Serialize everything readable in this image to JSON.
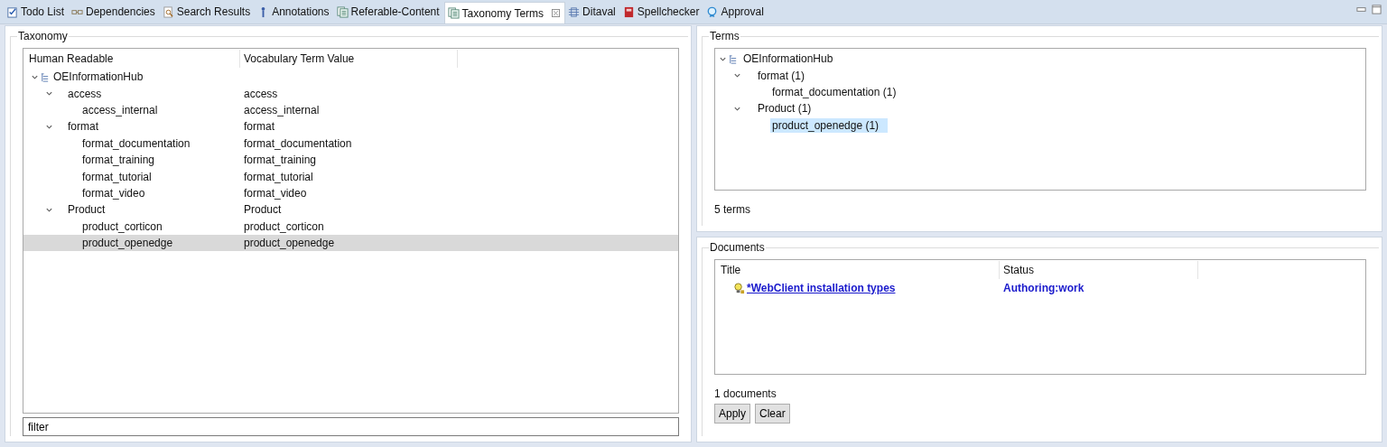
{
  "tabs": [
    {
      "label": "Todo List",
      "kind": "todo",
      "selected": false
    },
    {
      "label": "Dependencies",
      "kind": "dependencies",
      "selected": false
    },
    {
      "label": "Search Results",
      "kind": "search",
      "selected": false
    },
    {
      "label": "Annotations",
      "kind": "annotations",
      "selected": false
    },
    {
      "label": "Referable-Content",
      "kind": "document",
      "selected": false
    },
    {
      "label": "Taxonomy Terms",
      "kind": "document",
      "selected": true
    },
    {
      "label": "Ditaval",
      "kind": "ditaval",
      "selected": false
    },
    {
      "label": "Spellchecker",
      "kind": "spellcheck",
      "selected": false
    },
    {
      "label": "Approval",
      "kind": "approval",
      "selected": false
    }
  ],
  "taxonomy": {
    "title": "Taxonomy",
    "columns": [
      "Human Readable",
      "Vocabulary Term Value"
    ],
    "tree": [
      {
        "label": "OEInformationHub",
        "kind": "vocabulary",
        "expanded": true,
        "selected": false,
        "children": [
          {
            "label": "access",
            "value": "access",
            "expanded": true,
            "selected": false,
            "children": [
              {
                "label": "access_internal",
                "value": "access_internal",
                "selected": false
              }
            ]
          },
          {
            "label": "format",
            "value": "format",
            "expanded": true,
            "selected": false,
            "children": [
              {
                "label": "format_documentation",
                "value": "format_documentation",
                "selected": false
              },
              {
                "label": "format_training",
                "value": "format_training",
                "selected": false
              },
              {
                "label": "format_tutorial",
                "value": "format_tutorial",
                "selected": false
              },
              {
                "label": "format_video",
                "value": "format_video",
                "selected": false
              }
            ]
          },
          {
            "label": "Product",
            "value": "Product",
            "expanded": true,
            "selected": false,
            "children": [
              {
                "label": "product_corticon",
                "value": "product_corticon",
                "selected": false
              },
              {
                "label": "product_openedge",
                "value": "product_openedge",
                "selected": true
              }
            ]
          }
        ]
      }
    ],
    "filter": {
      "value": "filter"
    }
  },
  "terms": {
    "title": "Terms",
    "tree": [
      {
        "label": "OEInformationHub",
        "kind": "vocabulary",
        "expanded": true,
        "selected": false,
        "children": [
          {
            "label": "format (1)",
            "expanded": true,
            "selected": false,
            "children": [
              {
                "label": "format_documentation (1)",
                "selected": false
              }
            ]
          },
          {
            "label": "Product (1)",
            "expanded": true,
            "selected": false,
            "children": [
              {
                "label": "product_openedge (1)",
                "selected": true
              }
            ]
          }
        ]
      }
    ],
    "count": "5 terms"
  },
  "documents": {
    "title": "Documents",
    "columns": [
      "Title",
      "Status"
    ],
    "rows": [
      {
        "title": "*WebClient installation types",
        "status": "Authoring:work"
      }
    ],
    "count": "1 documents",
    "buttons": [
      "Apply",
      "Clear"
    ]
  }
}
